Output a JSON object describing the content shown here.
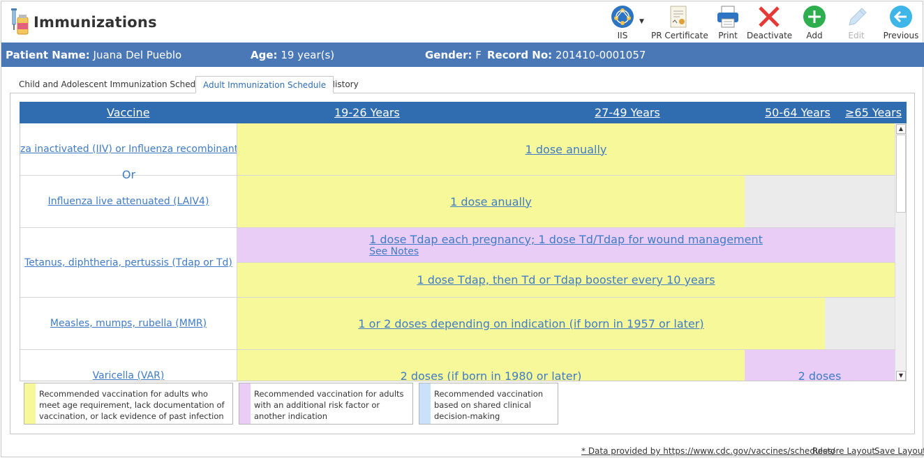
{
  "app": {
    "title": "Immunizations"
  },
  "toolbar": {
    "iis_label": "IIS",
    "certificate_label": "PR Certificate",
    "print_label": "Print",
    "deactivate_label": "Deactivate",
    "add_label": "Add",
    "edit_label": "Edit",
    "previous_label": "Previous"
  },
  "patient": {
    "name_label": "Patient Name:",
    "name": "Juana Del Pueblo",
    "age_label": "Age:",
    "age": "19 year(s)",
    "gender_label": "Gender:",
    "gender": "F",
    "record_label": "Record No:",
    "record": "201410-0001057"
  },
  "tabs": [
    {
      "label": "Child and Adolescent Immunization Schedule",
      "active": false
    },
    {
      "label": "Adult Immunization Schedule",
      "active": true
    },
    {
      "label": "History",
      "active": false
    }
  ],
  "schedule": {
    "headers": [
      "Vaccine",
      "19-26 Years",
      "27-49 Years",
      "50-64 Years",
      "≥65 Years"
    ],
    "rows": [
      {
        "vaccine": "za inactivated (IIV) or Influenza recombinant",
        "dose": "1 dose anually"
      },
      {
        "or_label": "Or"
      },
      {
        "vaccine": "Influenza live attenuated (LAIV4)",
        "dose": "1 dose anually"
      },
      {
        "vaccine": "Tetanus, diphtheria, pertussis (Tdap or Td)",
        "dose_pregnancy": "1 dose Tdap each pregnancy; 1 dose Td/Tdap for wound management",
        "see_notes": "See Notes",
        "dose": "1 dose Tdap, then Td or Tdap booster every 10 years"
      },
      {
        "vaccine": "Measles, mumps, rubella (MMR)",
        "dose": "1 or 2 doses depending on indication (if born in 1957 or later)"
      },
      {
        "vaccine": "Varicella (VAR)",
        "dose": "2 doses (if born in 1980 or later)",
        "dose_risk": "2 doses"
      }
    ]
  },
  "legend": [
    {
      "text": "Recommended vaccination for adults who meet age requirement, lack documentation of vaccination, or lack evidence of past infection",
      "color": "#f7f89a"
    },
    {
      "text": "Recommended vaccination for adults with an additional risk factor or another indication",
      "color": "#e9cdf6"
    },
    {
      "text": "Recommended vaccination based on shared clinical decision-making",
      "color": "#c9e1fb"
    }
  ],
  "footer": {
    "source": "* Data provided by https://www.cdc.gov/vaccines/schedules/",
    "restore": "Restore Layout",
    "save": "Save Layout"
  },
  "colors": {
    "header_bar": "#4a78b7",
    "table_header": "#2f6db0",
    "link": "#3f7bc6",
    "routine": "#f7f89a",
    "risk": "#e9cdf6",
    "shared": "#c9e1fb",
    "not_recommended": "#ebebeb"
  },
  "icons": {
    "app": "syringe-vial-icon",
    "iis": "network-globe-icon",
    "certificate": "certificate-icon",
    "print": "printer-icon",
    "deactivate": "red-x-icon",
    "add": "plus-circle-icon",
    "edit": "pencil-icon",
    "previous": "back-arrow-icon"
  }
}
